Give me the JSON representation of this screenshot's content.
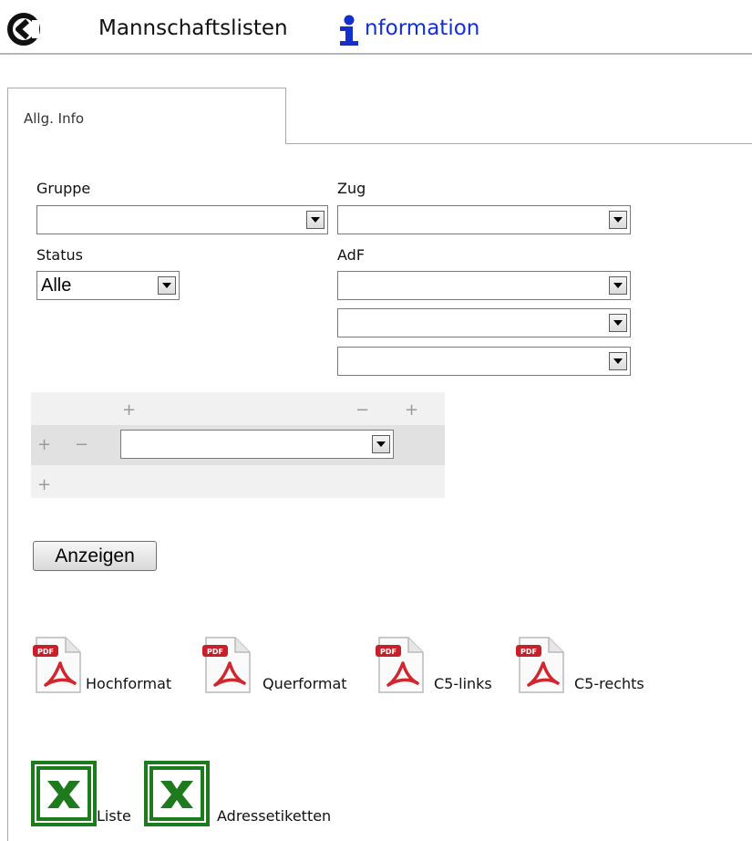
{
  "header": {
    "back_icon": "back-arrow-icon",
    "title": "Mannschaftslisten",
    "info_icon": "info-icon",
    "info_label": "nformation",
    "info_color": "#1330cc"
  },
  "tabs": [
    {
      "label": "Allg. Info",
      "active": true
    }
  ],
  "form": {
    "gruppe": {
      "label": "Gruppe",
      "value": ""
    },
    "zug": {
      "label": "Zug",
      "value": ""
    },
    "status": {
      "label": "Status",
      "value": "Alle"
    },
    "adf": {
      "label": "AdF",
      "values": [
        "",
        "",
        ""
      ]
    }
  },
  "filter": {
    "row1": [
      "+",
      "−",
      "+"
    ],
    "row2_controls": [
      "+",
      "−"
    ],
    "row2_select_value": "",
    "row3": [
      "+"
    ]
  },
  "buttons": {
    "show": "Anzeigen"
  },
  "pdf_exports": [
    {
      "label": "Hochformat",
      "icon": "pdf-icon"
    },
    {
      "label": "Querformat",
      "icon": "pdf-icon"
    },
    {
      "label": "C5-links",
      "icon": "pdf-icon"
    },
    {
      "label": "C5-rechts",
      "icon": "pdf-icon"
    }
  ],
  "excel_exports": [
    {
      "label": "Liste",
      "icon": "excel-icon"
    },
    {
      "label": "Adressetiketten",
      "icon": "excel-icon"
    }
  ],
  "colors": {
    "pdf_red": "#c8202a",
    "excel_green": "#1d7a1d",
    "grid_light": "#f1f1f1",
    "grid_dark": "#e1e1e1"
  }
}
